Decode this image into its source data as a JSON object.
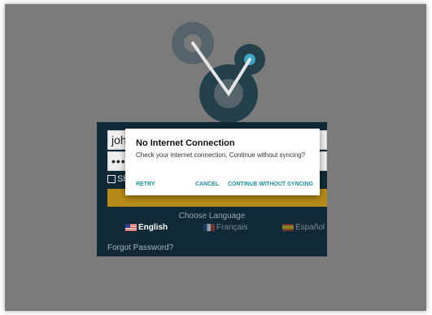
{
  "colors": {
    "overlay": "#7b7b7b",
    "panel": "#0f2a36",
    "accent": "#1f8fa3",
    "login_button": "#b58a17"
  },
  "login": {
    "username_value": "joh",
    "password_value": "•••",
    "show_password_label": "Sh",
    "choose_language_label": "Choose Language",
    "languages": [
      {
        "label": "English",
        "icon": "us-flag-icon"
      },
      {
        "label": "Français",
        "icon": "france-flag-icon"
      },
      {
        "label": "Español",
        "icon": "spain-flag-icon"
      }
    ],
    "forgot_password_label": "Forgot Password?"
  },
  "dialog": {
    "title": "No Internet Connection",
    "message": "Check your internet connection. Continue without syncing?",
    "retry_label": "RETRY",
    "cancel_label": "CANCEL",
    "continue_label": "CONTINUE WITHOUT SYNCING"
  }
}
